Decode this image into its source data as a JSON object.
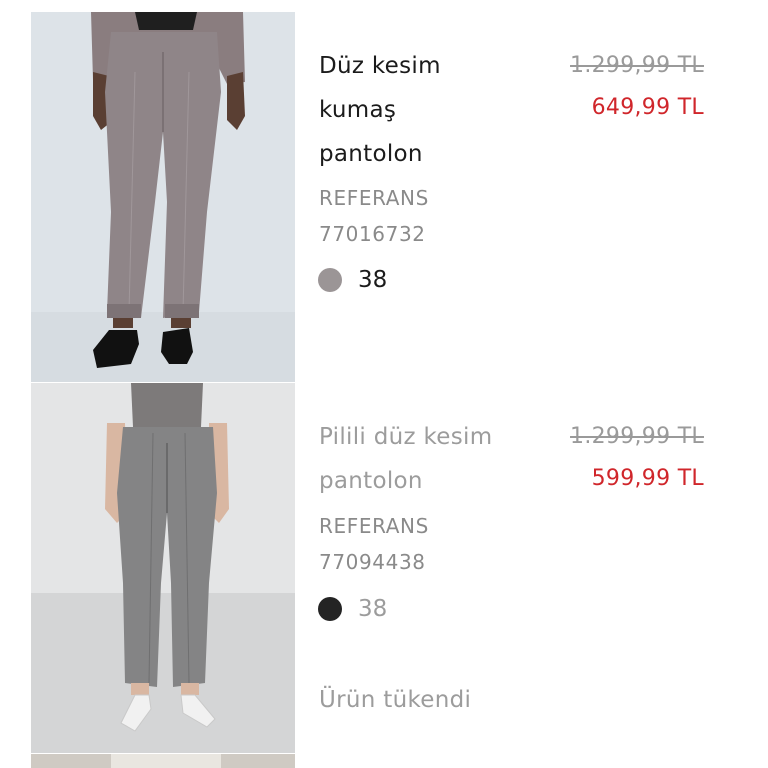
{
  "products": [
    {
      "name_line1": "Düz kesim",
      "name_line2": "kumaş",
      "name_line3": "pantolon",
      "original_price": "1.299,99 TL",
      "sale_price": "649,99 TL",
      "reference_label": "REFERANS",
      "reference_number": "77016732",
      "size": "38",
      "swatch_color": "#9b9596",
      "available": true
    },
    {
      "name_line1": "Pilili düz kesim",
      "name_line2": "pantolon",
      "original_price": "1.299,99 TL",
      "sale_price": "599,99 TL",
      "reference_label": "REFERANS",
      "reference_number": "77094438",
      "size": "38",
      "swatch_color": "#242424",
      "available": false,
      "stock_status": "Ürün tükendi"
    }
  ],
  "colors": {
    "sale_price": "#d0262b",
    "muted_text": "#9c9c9c",
    "primary_text": "#1b1b1b"
  }
}
